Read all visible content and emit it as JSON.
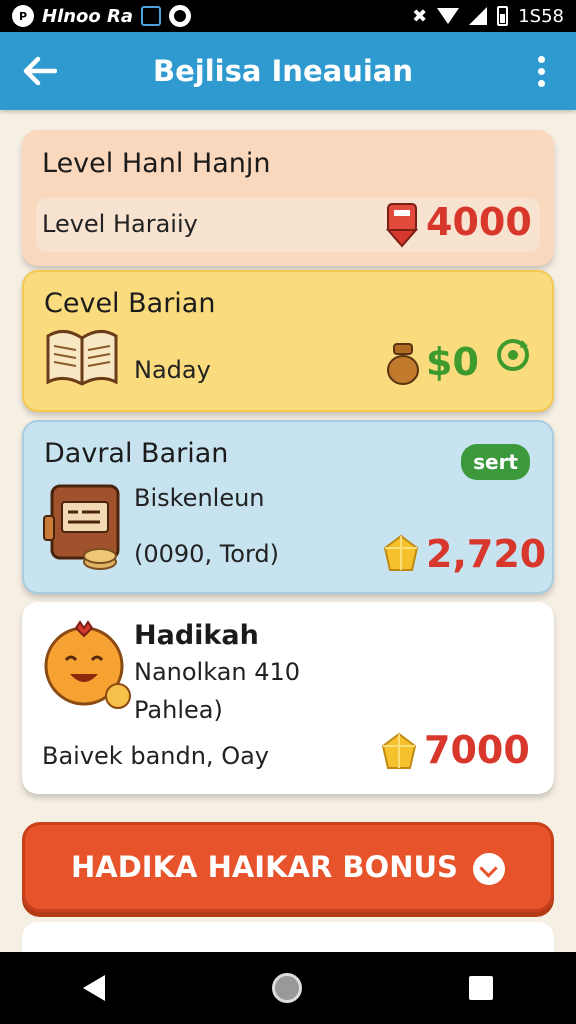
{
  "status_bar": {
    "carrier": "Hlnoo Ra",
    "time": "1S58"
  },
  "app_bar": {
    "title": "Bejlisa Ineauian"
  },
  "cards": [
    {
      "title": "Level Hanl Hanjn",
      "text": "Level Haraiiy",
      "amount": "4000",
      "amount_color": "#d8372b",
      "icon": "red-shield-icon"
    },
    {
      "title": "Cevel Barian",
      "text": "Naday",
      "amount": "$0",
      "amount_color": "#3e9a2c",
      "icon": "open-book-icon"
    },
    {
      "title": "Davral Barian",
      "line1": "Biskenleun",
      "line2": "(0090, Tord)",
      "amount": "2,720",
      "amount_color": "#d8372b",
      "badge": "sert",
      "icon": "treasure-chest-icon"
    },
    {
      "title": "Hadikah",
      "line1": "Nanolkan 410",
      "line2": "Pahlea)",
      "line3": "Baivek bandn, Oay",
      "amount": "7000",
      "amount_color": "#d8372b",
      "icon": "smiley-mascot-icon"
    }
  ],
  "bonus_button": {
    "label": "HADIKA HAIKAR BONUS"
  }
}
